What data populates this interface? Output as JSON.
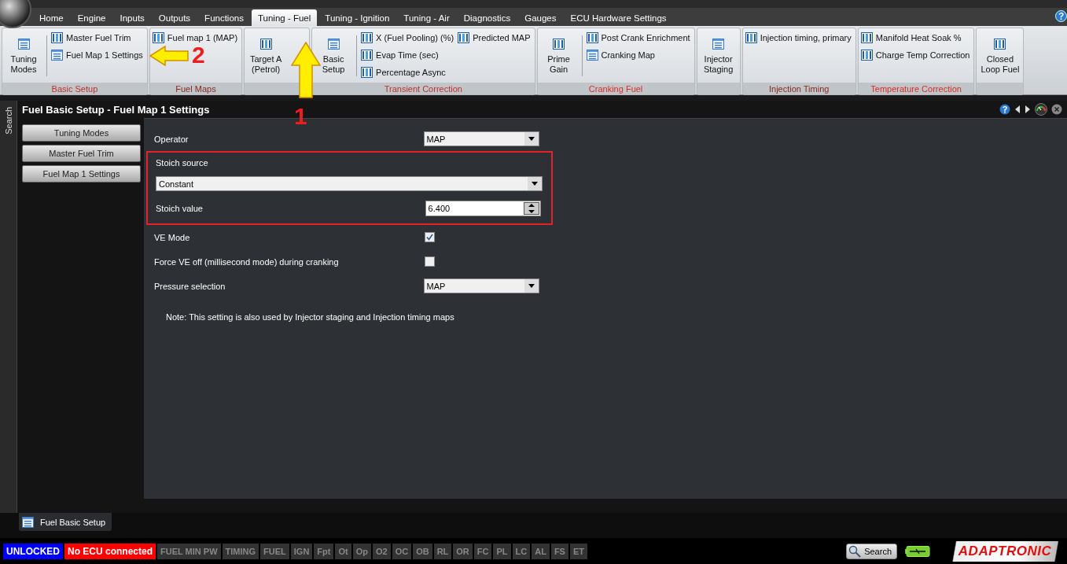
{
  "tabs": [
    {
      "label": "Home",
      "selected": false
    },
    {
      "label": "Engine",
      "selected": false
    },
    {
      "label": "Inputs",
      "selected": false
    },
    {
      "label": "Outputs",
      "selected": false
    },
    {
      "label": "Functions",
      "selected": false
    },
    {
      "label": "Tuning - Fuel",
      "selected": true
    },
    {
      "label": "Tuning - Ignition",
      "selected": false
    },
    {
      "label": "Tuning - Air",
      "selected": false
    },
    {
      "label": "Diagnostics",
      "selected": false
    },
    {
      "label": "Gauges",
      "selected": false
    },
    {
      "label": "ECU Hardware Settings",
      "selected": false
    }
  ],
  "ribbon": [
    {
      "label": "Basic Setup",
      "color": "#c0302a",
      "large": [
        {
          "label": "Tuning\nModes",
          "kind": "list"
        }
      ],
      "columns": [
        [
          {
            "label": "Master Fuel Trim",
            "kind": "grid"
          },
          {
            "label": "Fuel Map 1 Settings",
            "kind": "list"
          }
        ]
      ]
    },
    {
      "label": "Fuel Maps",
      "color": "#8a2a1a",
      "columns": [
        [
          {
            "label": "Fuel map 1 (MAP)",
            "kind": "grid"
          }
        ]
      ]
    },
    {
      "large": [
        {
          "label": "Target A\n(Petrol)",
          "kind": "grid"
        }
      ]
    },
    {
      "label": "Transient Correction",
      "color": "#c0302a",
      "large": [
        {
          "label": "Basic\nSetup",
          "kind": "list"
        }
      ],
      "columns": [
        [
          {
            "label": "X (Fuel Pooling) (%)",
            "kind": "grid"
          },
          {
            "label": "Evap Time (sec)",
            "kind": "grid"
          },
          {
            "label": "Percentage Async",
            "kind": "grid"
          }
        ],
        [
          {
            "label": "Predicted MAP",
            "kind": "grid"
          }
        ]
      ]
    },
    {
      "label": "Cranking Fuel",
      "color": "#e02a20",
      "large": [
        {
          "label": "Prime\nGain",
          "kind": "grid"
        }
      ],
      "columns": [
        [
          {
            "label": "Post Crank Enrichment",
            "kind": "grid"
          },
          {
            "label": "Cranking Map",
            "kind": "list"
          }
        ]
      ]
    },
    {
      "large": [
        {
          "label": "Injector\nStaging",
          "kind": "list"
        }
      ]
    },
    {
      "label": "Injection Timing",
      "color": "#8a2a1a",
      "columns": [
        [
          {
            "label": "Injection timing, primary",
            "kind": "grid"
          }
        ]
      ]
    },
    {
      "label": "Temperature Correction",
      "color": "#e02a20",
      "columns": [
        [
          {
            "label": "Manifold Heat Soak %",
            "kind": "grid"
          },
          {
            "label": "Charge Temp Correction",
            "kind": "grid"
          }
        ]
      ]
    },
    {
      "large": [
        {
          "label": "Closed\nLoop Fuel",
          "kind": "grid"
        }
      ]
    }
  ],
  "annotations": [
    {
      "label": "1",
      "kind": "up"
    },
    {
      "label": "2",
      "kind": "left"
    }
  ],
  "side_strip": {
    "label": "Search"
  },
  "panel": {
    "title": "Fuel Basic Setup - Fuel Map 1 Settings",
    "nav": [
      "Tuning Modes",
      "Master Fuel Trim",
      "Fuel Map 1 Settings"
    ],
    "rows": [
      {
        "kind": "select",
        "label": "Operator",
        "value": "MAP"
      },
      {
        "kind": "group",
        "highlighted": true,
        "children": [
          {
            "kind": "wide-select",
            "label": "Stoich source",
            "value": "Constant"
          },
          {
            "kind": "number",
            "label": "Stoich value",
            "value": "6.400"
          }
        ]
      },
      {
        "kind": "checkbox",
        "label": "VE Mode",
        "checked": true
      },
      {
        "kind": "checkbox",
        "label": "Force VE off (millisecond mode) during cranking",
        "checked": false
      },
      {
        "kind": "select",
        "label": "Pressure selection",
        "value": "MAP"
      }
    ],
    "note": "Note: This setting is also used by Injector staging and Injection timing maps"
  },
  "bottom_tab": {
    "label": "Fuel Basic Setup"
  },
  "status_bar": {
    "badges": [
      {
        "label": "UNLOCKED",
        "color": "#0000ff"
      },
      {
        "label": "No ECU connected",
        "color": "#ff0000"
      },
      {
        "label": "FUEL MIN PW",
        "color": "#333333"
      },
      {
        "label": "TIMING",
        "color": "#333333"
      },
      {
        "label": "FUEL",
        "color": "#333333"
      },
      {
        "label": "IGN",
        "color": "#333333"
      },
      {
        "label": "Fpt",
        "color": "#333333"
      },
      {
        "label": "Ot",
        "color": "#333333"
      },
      {
        "label": "Op",
        "color": "#333333"
      },
      {
        "label": "O2",
        "color": "#333333"
      },
      {
        "label": "OC",
        "color": "#333333"
      },
      {
        "label": "OB",
        "color": "#333333"
      },
      {
        "label": "RL",
        "color": "#333333"
      },
      {
        "label": "OR",
        "color": "#333333"
      },
      {
        "label": "FC",
        "color": "#333333"
      },
      {
        "label": "PL",
        "color": "#333333"
      },
      {
        "label": "LC",
        "color": "#333333"
      },
      {
        "label": "AL",
        "color": "#333333"
      },
      {
        "label": "FS",
        "color": "#333333"
      },
      {
        "label": "ET",
        "color": "#333333"
      }
    ],
    "search_button": "Search",
    "logo": "ADAPTRONIC"
  }
}
